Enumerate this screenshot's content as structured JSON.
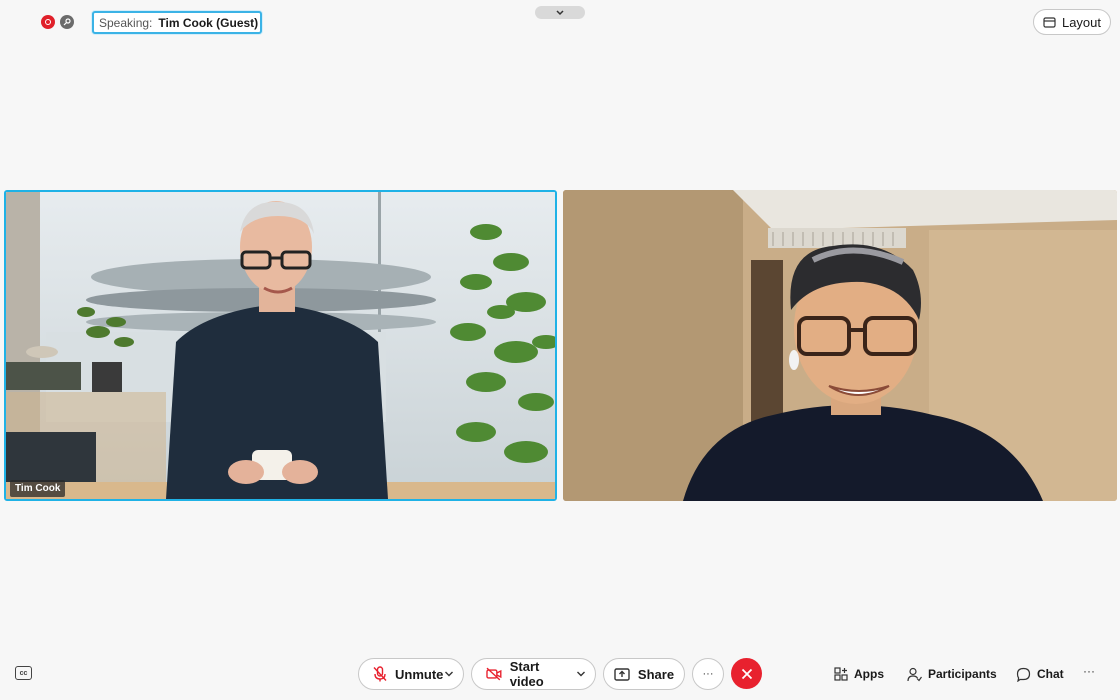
{
  "header": {
    "speaking_label": "Speaking:",
    "speaking_name": "Tim Cook (Guest)",
    "layout_label": "Layout"
  },
  "tiles": [
    {
      "name": "Tim Cook",
      "active_speaker": true
    },
    {
      "name": ""
    }
  ],
  "controls": {
    "cc_label": "cc",
    "unmute_label": "Unmute",
    "start_video_label": "Start video",
    "share_label": "Share",
    "more_label": "···",
    "apps_label": "Apps",
    "participants_label": "Participants",
    "chat_label": "Chat",
    "overflow_label": "···"
  },
  "colors": {
    "accent": "#1fb2e6",
    "end_call": "#e8212e",
    "mute_icon": "#e8212e",
    "recording": "#e0202a"
  },
  "icons": {
    "recording": "recording-icon",
    "lock": "lock-icon",
    "layout": "layout-icon",
    "mic_off": "mic-off-icon",
    "video_off": "video-off-icon",
    "share": "share-icon",
    "end": "close-icon",
    "apps": "apps-icon",
    "participants": "participants-icon",
    "chat": "chat-icon"
  }
}
